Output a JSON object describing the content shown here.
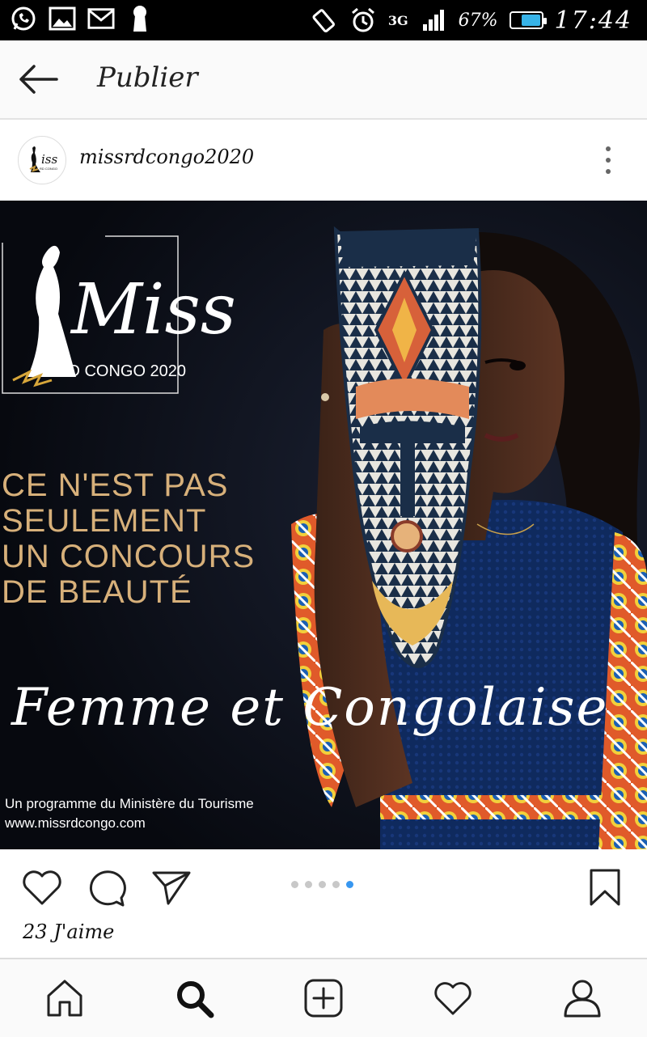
{
  "status_bar": {
    "left_icons": [
      "whatsapp-icon",
      "gallery-icon",
      "gmail-icon",
      "keyhole-icon"
    ],
    "network": "3G",
    "battery": "67%",
    "battery_level": 0.67,
    "time": "17:44",
    "battery_color": "#37b3e8"
  },
  "topbar": {
    "title": "Publier",
    "back_icon": "arrow-left-icon"
  },
  "post": {
    "username": "missrdcongo2020",
    "image": {
      "logo_main": "Miss",
      "logo_sub": "RD CONGO 2020",
      "tagline_lines": [
        "CE N'EST PAS",
        "SEULEMENT",
        "UN CONCOURS",
        "DE BEAUTÉ"
      ],
      "script_text": "Femme et Congolaise",
      "footer_line1": "Un programme du Ministère du Tourisme",
      "footer_line2": "www.missrdcongo.com"
    },
    "carousel": {
      "count": 5,
      "active_index": 4
    },
    "likes": "23 J'aime"
  },
  "colors": {
    "accent": "#3897f0",
    "gold": "#d7b07a",
    "dark_bg": "#0b0e18"
  },
  "bottom_nav": [
    "home-icon",
    "search-icon",
    "add-post-icon",
    "activity-heart-icon",
    "profile-icon"
  ]
}
